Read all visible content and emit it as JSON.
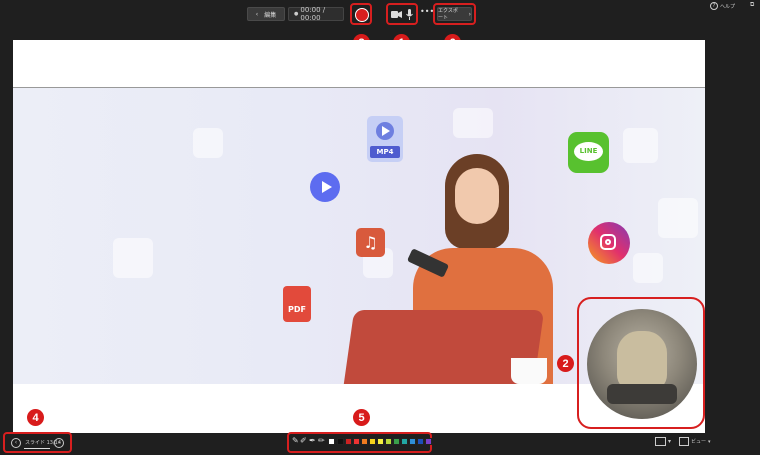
{
  "topbar": {
    "edit_label": "編集",
    "timer": "00:00 / 00:00",
    "export_label": "エクスポート",
    "help_label": "ヘルプ"
  },
  "callouts": [
    "3",
    "1",
    "6",
    "2",
    "4",
    "5"
  ],
  "slide_icons": {
    "mp4": "MP4",
    "line": "LINE",
    "pdf": "PDF"
  },
  "bottombar": {
    "slide_counter": "スライド 13/14",
    "view_label": "ビュー"
  },
  "palette": [
    "#ffffff",
    "#111111",
    "#cc2222",
    "#ee3333",
    "#f07b20",
    "#f5d21c",
    "#f4ee40",
    "#b9d93a",
    "#3aa04b",
    "#22a7a3",
    "#2f8fd8",
    "#1d4fb8",
    "#7a3fc9"
  ],
  "colors": {
    "accent_red": "#d71f1f",
    "background": "#1f1f1f"
  }
}
